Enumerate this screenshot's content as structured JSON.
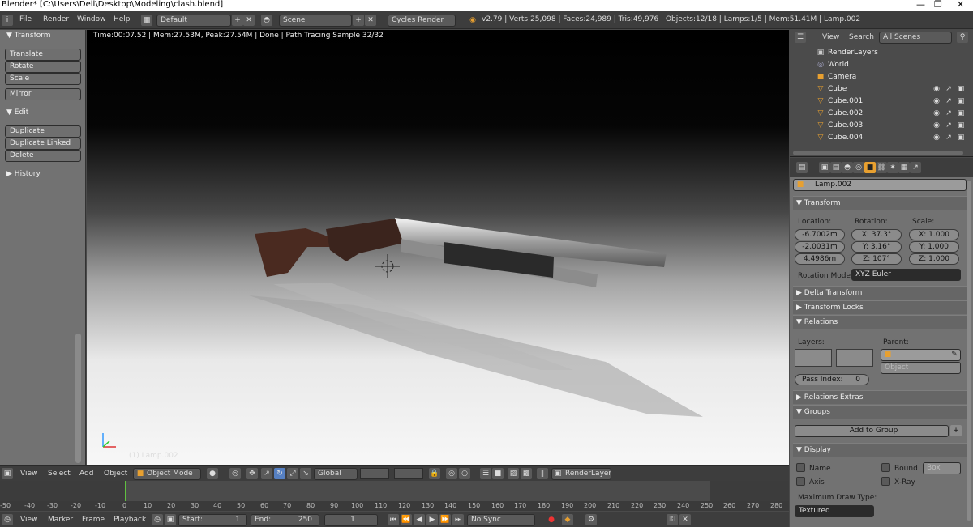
{
  "window": {
    "title": "Blender* [C:\\Users\\Dell\\Desktop\\Modeling\\clash.blend]"
  },
  "menu": [
    "File",
    "Render",
    "Window",
    "Help"
  ],
  "screen_layout": "Default",
  "scene": "Scene",
  "render_engine": "Cycles Render",
  "stats": "v2.79 | Verts:25,098 | Faces:24,989 | Tris:49,976 | Objects:12/18 | Lamps:1/5 | Mem:51.41M | Lamp.002",
  "tool_shelf": {
    "transform_header": "Transform",
    "transform_buttons": [
      "Translate",
      "Rotate",
      "Scale"
    ],
    "mirror": "Mirror",
    "edit_header": "Edit",
    "edit_buttons": [
      "Duplicate",
      "Duplicate Linked",
      "Delete"
    ],
    "history_header": "History"
  },
  "viewport": {
    "info": "Time:00:07.52 | Mem:27.53M, Peak:27.54M | Done | Path Tracing Sample 32/32",
    "active_object": "(1) Lamp.002"
  },
  "outliner": {
    "menu": [
      "View",
      "Search"
    ],
    "filter": "All Scenes",
    "items": [
      "RenderLayers",
      "World",
      "Camera",
      "Cube",
      "Cube.001",
      "Cube.002",
      "Cube.003",
      "Cube.004"
    ]
  },
  "properties": {
    "object_name": "Lamp.002",
    "transform": {
      "header": "Transform",
      "location_label": "Location:",
      "rotation_label": "Rotation:",
      "scale_label": "Scale:",
      "location": [
        "-6.7002m",
        "-2.0031m",
        "4.4986m"
      ],
      "rotation": [
        {
          "axis": "X:",
          "value": "37.3°"
        },
        {
          "axis": "Y:",
          "value": "3.16°"
        },
        {
          "axis": "Z:",
          "value": "107°"
        }
      ],
      "scale": [
        {
          "axis": "X:",
          "value": "1.000"
        },
        {
          "axis": "Y:",
          "value": "1.000"
        },
        {
          "axis": "Z:",
          "value": "1.000"
        }
      ],
      "rotation_mode_label": "Rotation Mode:",
      "rotation_mode": "XYZ Euler"
    },
    "delta_transform": "Delta Transform",
    "transform_locks": "Transform Locks",
    "relations": {
      "header": "Relations",
      "layers_label": "Layers:",
      "parent_label": "Parent:",
      "parent_type": "Object",
      "pass_index_label": "Pass Index:",
      "pass_index": "0"
    },
    "relations_extras": "Relations Extras",
    "groups": {
      "header": "Groups",
      "add_to_group": "Add to Group"
    },
    "display": {
      "header": "Display",
      "name": "Name",
      "axis": "Axis",
      "bound": "Bound",
      "bound_type": "Box",
      "xray": "X-Ray",
      "max_draw_type_label": "Maximum Draw Type:",
      "max_draw_type": "Textured"
    }
  },
  "viewport_header": {
    "menu": [
      "View",
      "Select",
      "Add",
      "Object"
    ],
    "mode": "Object Mode",
    "orientation": "Global",
    "render_layer": "RenderLayer"
  },
  "timeline": {
    "ticks": [
      "-50",
      "-40",
      "-30",
      "-20",
      "-10",
      "0",
      "10",
      "20",
      "30",
      "40",
      "50",
      "60",
      "70",
      "80",
      "90",
      "100",
      "110",
      "120",
      "130",
      "140",
      "150",
      "160",
      "170",
      "180",
      "190",
      "200",
      "210",
      "220",
      "230",
      "240",
      "250",
      "260",
      "270",
      "280"
    ],
    "menu": [
      "View",
      "Marker",
      "Frame",
      "Playback"
    ],
    "start_label": "Start:",
    "start": "1",
    "end_label": "End:",
    "end": "250",
    "current": "1",
    "sync": "No Sync"
  }
}
